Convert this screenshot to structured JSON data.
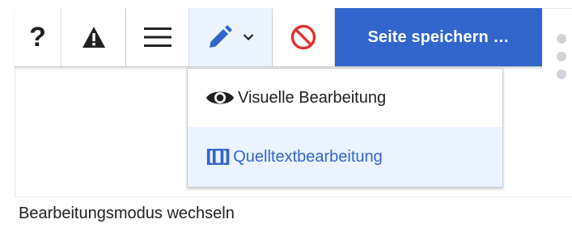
{
  "toolbar": {
    "help_glyph": "?",
    "save_label": "Seite speichern …",
    "icons": [
      "help-icon",
      "alert-icon",
      "menu-icon",
      "pencil-icon",
      "chevron-down-icon",
      "cancel-icon"
    ]
  },
  "dropdown": {
    "items": [
      {
        "label": "Visuelle Bearbeitung",
        "icon": "eye-icon",
        "selected": false
      },
      {
        "label": "Quelltextbearbeitung",
        "icon_text": "[[]]",
        "icon": "wikitext-icon",
        "selected": true
      }
    ]
  },
  "caption": "Bearbeitungsmodus wechseln",
  "colors": {
    "accent": "#3366cc",
    "selected_bg": "#eaf3ff",
    "text": "#202122",
    "cancel_red": "#d33"
  }
}
